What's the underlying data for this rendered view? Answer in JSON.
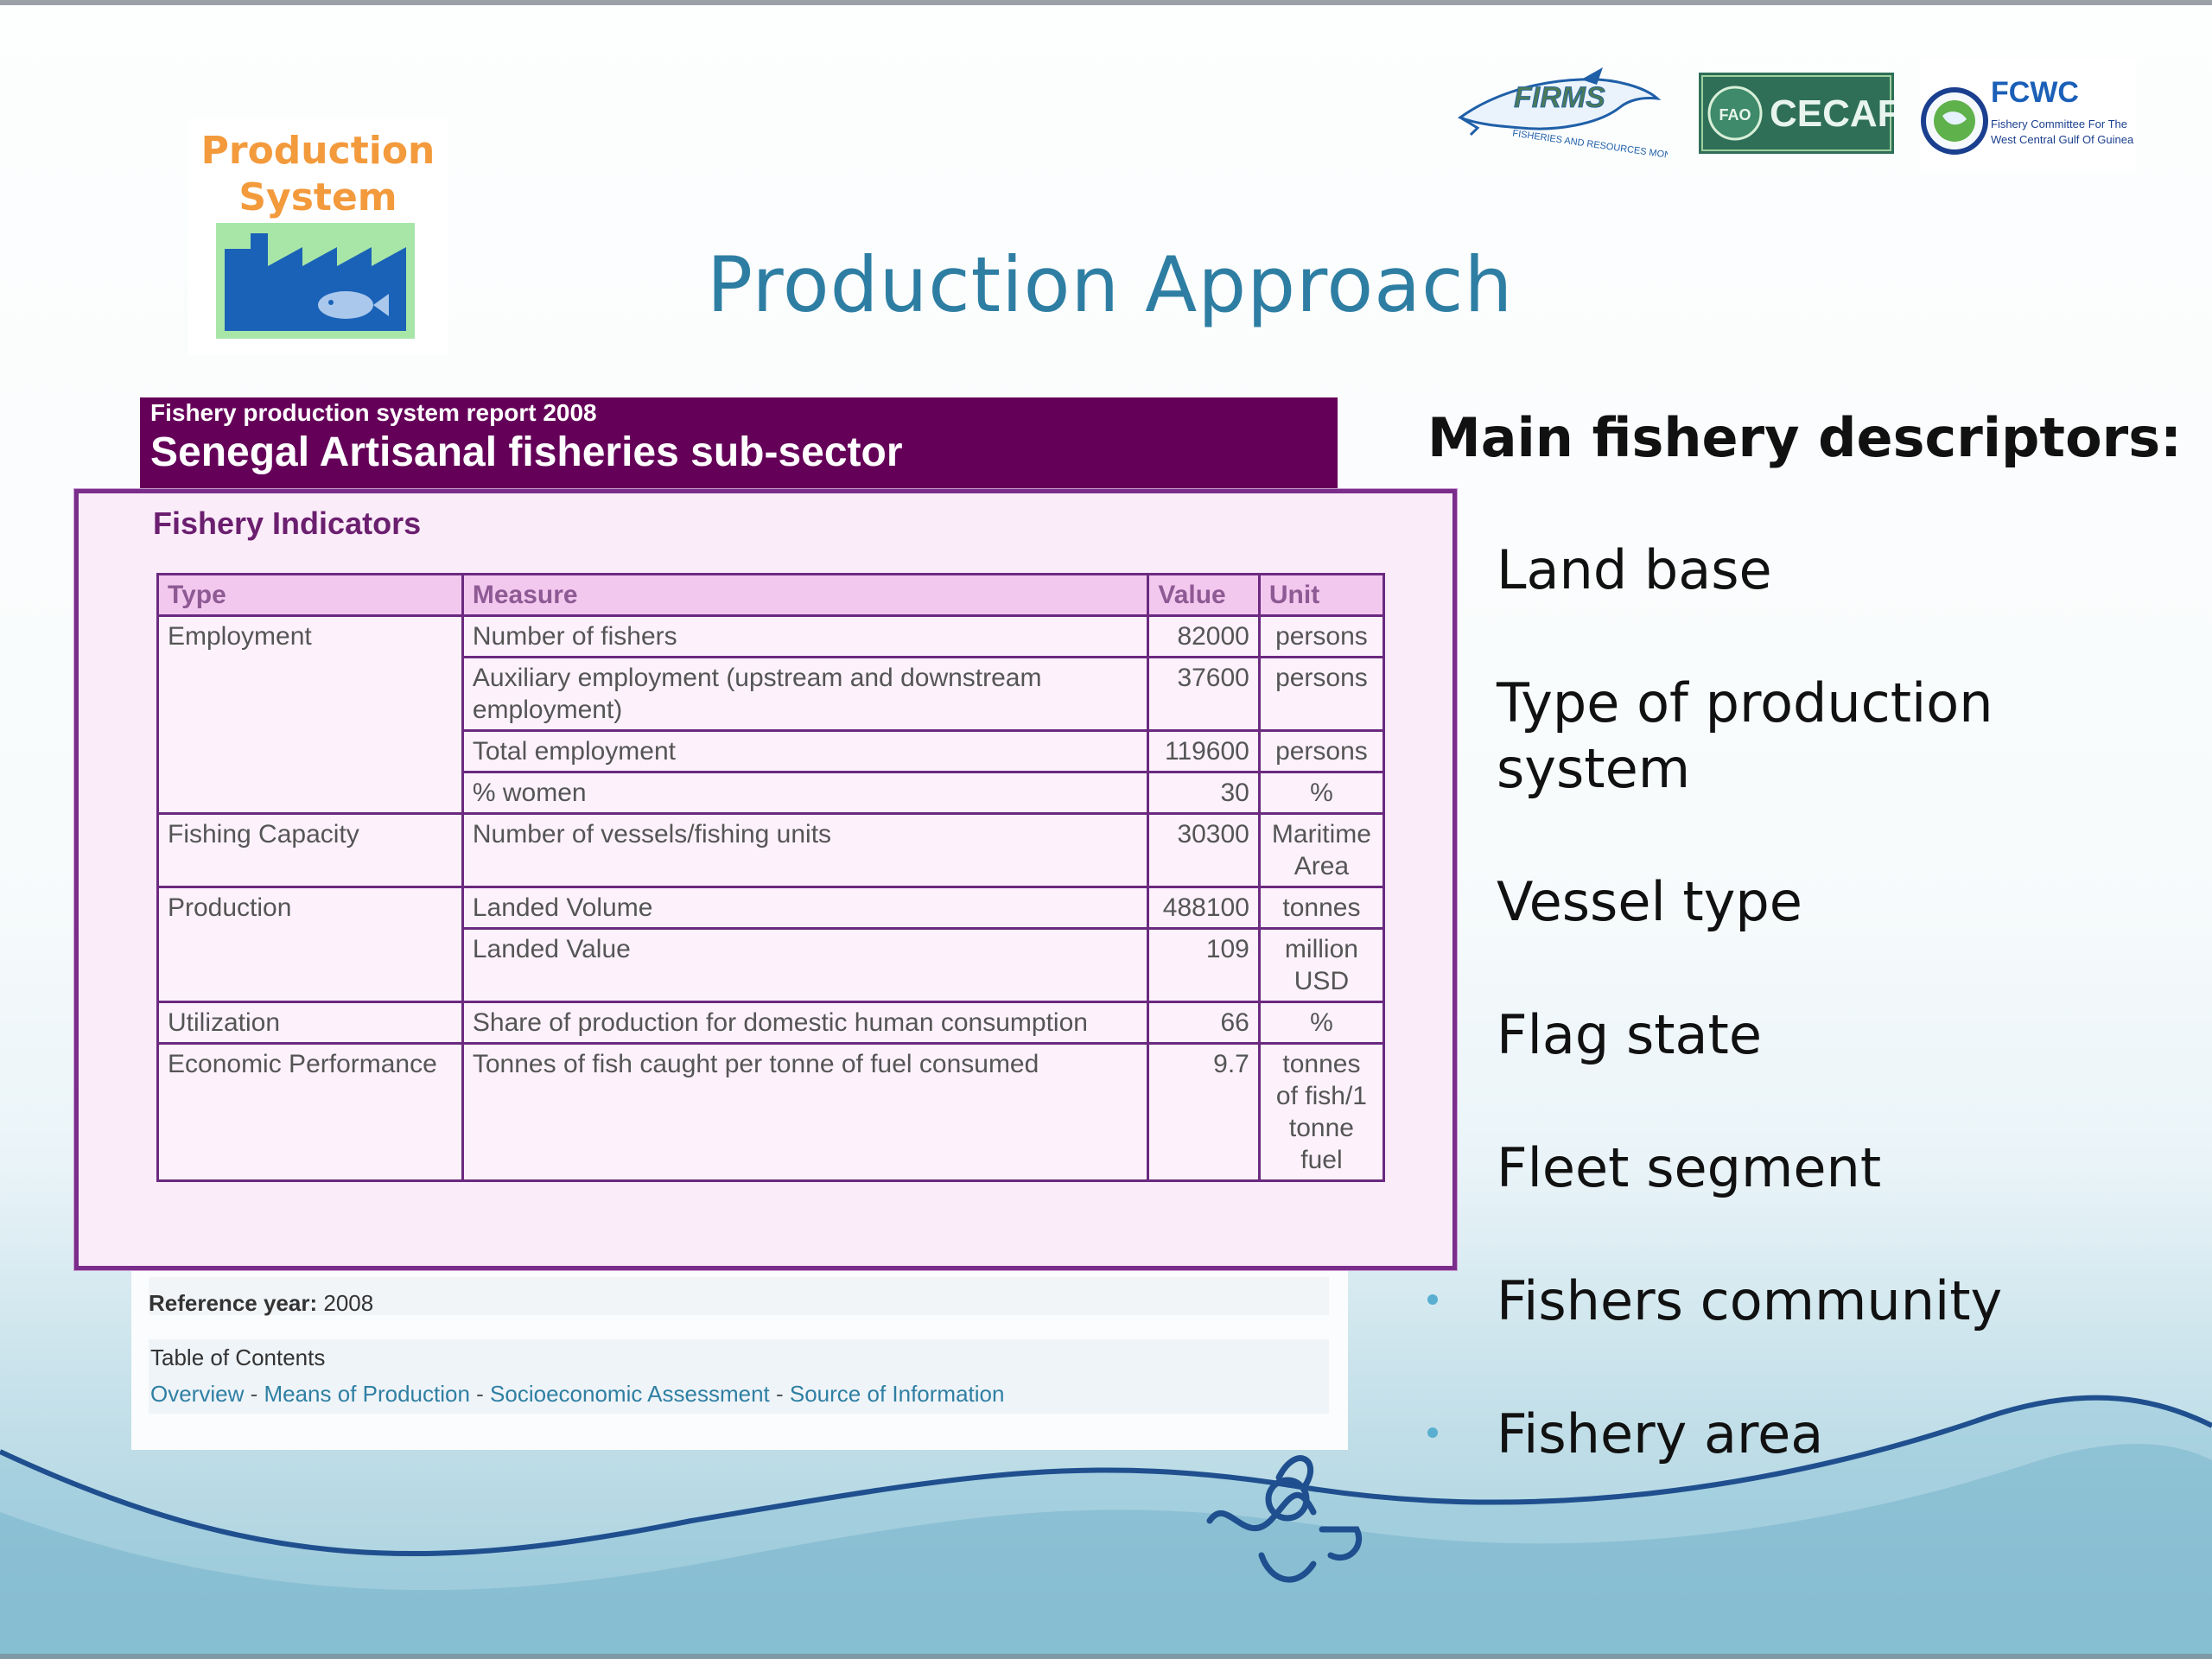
{
  "badge": {
    "title_line1": "Production",
    "title_line2": "System"
  },
  "logos": {
    "firms": {
      "text": "FIRMS",
      "tagline": "FISHERIES AND RESOURCES MONITORING SYSTEM"
    },
    "cecaf": {
      "text": "CECAF",
      "emblem": "FAO"
    },
    "fcwc": {
      "text": "FCWC",
      "tagline_line1": "Fishery Committee For The",
      "tagline_line2": "West Central Gulf Of Guinea"
    }
  },
  "slide_title": "Production Approach",
  "report": {
    "subtitle": "Fishery production system report 2008",
    "name": "Senegal Artisanal fisheries sub-sector",
    "reference_label": "Reference year:",
    "reference_year": "2008",
    "toc_heading": "Table of Contents",
    "toc_links": [
      "Overview",
      "Means of Production",
      "Socioeconomic Assessment",
      "Source of Information"
    ],
    "toc_separator": " - "
  },
  "indicators": {
    "title": "Fishery Indicators",
    "headers": [
      "Type",
      "Measure",
      "Value",
      "Unit"
    ],
    "rows": [
      {
        "type": "Employment",
        "measure": "Number of fishers",
        "value": "82000",
        "unit": "persons"
      },
      {
        "type": "",
        "measure": "Auxiliary employment (upstream and downstream employment)",
        "value": "37600",
        "unit": "persons"
      },
      {
        "type": "",
        "measure": "Total employment",
        "value": "119600",
        "unit": "persons"
      },
      {
        "type": "",
        "measure": "% women",
        "value": "30",
        "unit": "%"
      },
      {
        "type": "Fishing Capacity",
        "measure": "Number of vessels/fishing units",
        "value": "30300",
        "unit": "Maritime Area"
      },
      {
        "type": "Production",
        "measure": "Landed Volume",
        "value": "488100",
        "unit": "tonnes"
      },
      {
        "type": "",
        "measure": "Landed Value",
        "value": "109",
        "unit": "million USD"
      },
      {
        "type": "Utilization",
        "measure": "Share of production for domestic human consumption",
        "value": "66",
        "unit": "%"
      },
      {
        "type": "Economic Performance",
        "measure": "Tonnes of fish caught per tonne of fuel consumed",
        "value": "9.7",
        "unit": "tonnes of fish/1 tonne fuel"
      }
    ]
  },
  "descriptors": {
    "title": "Main fishery descriptors:",
    "items": [
      "Land base",
      "Type of  production system",
      "Vessel type",
      "Flag state",
      "Fleet segment",
      "Fishers community",
      "Fishery area"
    ]
  },
  "colors": {
    "title": "#2e7ea3",
    "report_header": "#650059",
    "popup_border": "#7a2d8a",
    "popup_bg": "#fbecfa",
    "table_header_bg": "#f3c8ef",
    "bullet": "#5aafd0",
    "link": "#2f7fa3",
    "badge_text": "#f39a3c"
  },
  "icons": {
    "badge": "factory-fish-icon",
    "bullets": "bullet-dot-icon",
    "footer": "wave-ornament-icon"
  }
}
